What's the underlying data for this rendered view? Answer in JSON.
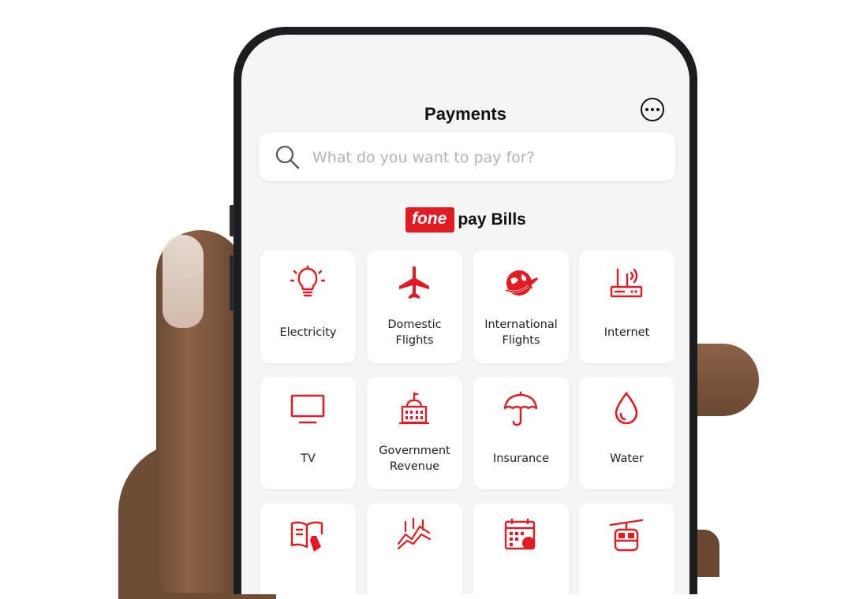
{
  "header": {
    "title": "Payments"
  },
  "search": {
    "placeholder": "What do you want to pay for?"
  },
  "brand": {
    "part1": "fone",
    "part2": "pay",
    "part3": "Bills"
  },
  "colors": {
    "accent": "#e11b22",
    "background": "#f5f5f5"
  },
  "tiles": [
    {
      "label": "Electricity",
      "icon": "lightbulb-icon"
    },
    {
      "label1": "Domestic",
      "label2": "Flights",
      "icon": "airplane-icon"
    },
    {
      "label1": "International",
      "label2": "Flights",
      "icon": "globe-airplane-icon"
    },
    {
      "label": "Internet",
      "icon": "router-icon"
    },
    {
      "label": "TV",
      "icon": "tv-icon"
    },
    {
      "label1": "Government",
      "label2": "Revenue",
      "icon": "government-building-icon"
    },
    {
      "label": "Insurance",
      "icon": "umbrella-icon"
    },
    {
      "label": "Water",
      "icon": "water-drop-icon"
    },
    {
      "icon": "book-pencil-icon"
    },
    {
      "icon": "stock-chart-icon"
    },
    {
      "icon": "calendar-icon"
    },
    {
      "icon": "cable-car-icon"
    }
  ]
}
